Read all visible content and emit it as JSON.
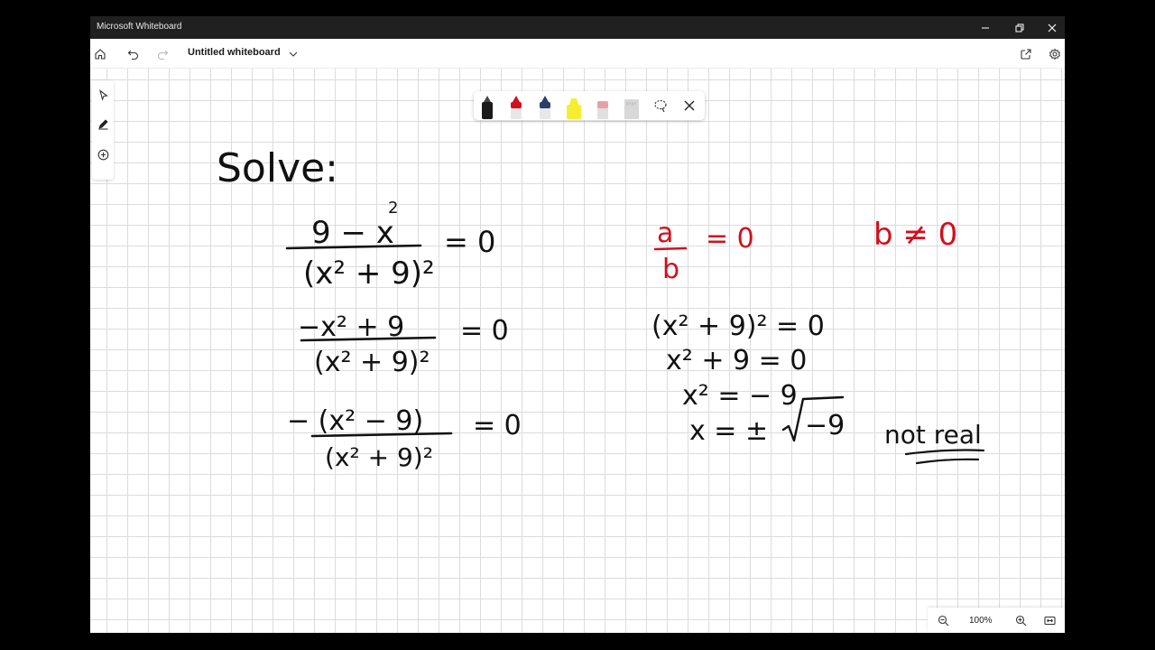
{
  "window": {
    "title": "Microsoft Whiteboard"
  },
  "toolbar": {
    "doc_title": "Untitled whiteboard"
  },
  "zoom": {
    "level": "100%"
  },
  "pen_tray": {
    "pens": [
      {
        "name": "black-pen",
        "color": "#1a1a1a"
      },
      {
        "name": "red-pen",
        "color": "#d0101e"
      },
      {
        "name": "blue-pen",
        "color": "#2b3f6b"
      },
      {
        "name": "yellow-highlighter",
        "color": "#f5ee30"
      },
      {
        "name": "eraser",
        "color": "#e8a0a8"
      },
      {
        "name": "ruler",
        "color": "#d8d8d8"
      }
    ]
  },
  "colors": {
    "ink_black": "#111111",
    "ink_red": "#d0101e",
    "grid": "#dcdcdc"
  },
  "ink": {
    "solve": "Solve:",
    "eq1": {
      "numerator": "9 − x",
      "num_exp": "2",
      "denominator": "(x² + 9)²",
      "rhs": "= 0"
    },
    "eq2": {
      "numerator": "−x² + 9",
      "denominator": "(x² + 9)²",
      "rhs": "= 0"
    },
    "eq3": {
      "numerator": "− (x² − 9)",
      "denominator": "(x² + 9)²",
      "rhs": "= 0"
    },
    "red_rule": {
      "numerator": "a",
      "denominator": "b",
      "rhs": "= 0"
    },
    "red_condition": "b ≠ 0",
    "steps": [
      "(x² + 9)² = 0",
      "x² + 9 = 0",
      "x² = − 9",
      "x = ±"
    ],
    "sqrt": "−9",
    "not_real": "not real"
  }
}
